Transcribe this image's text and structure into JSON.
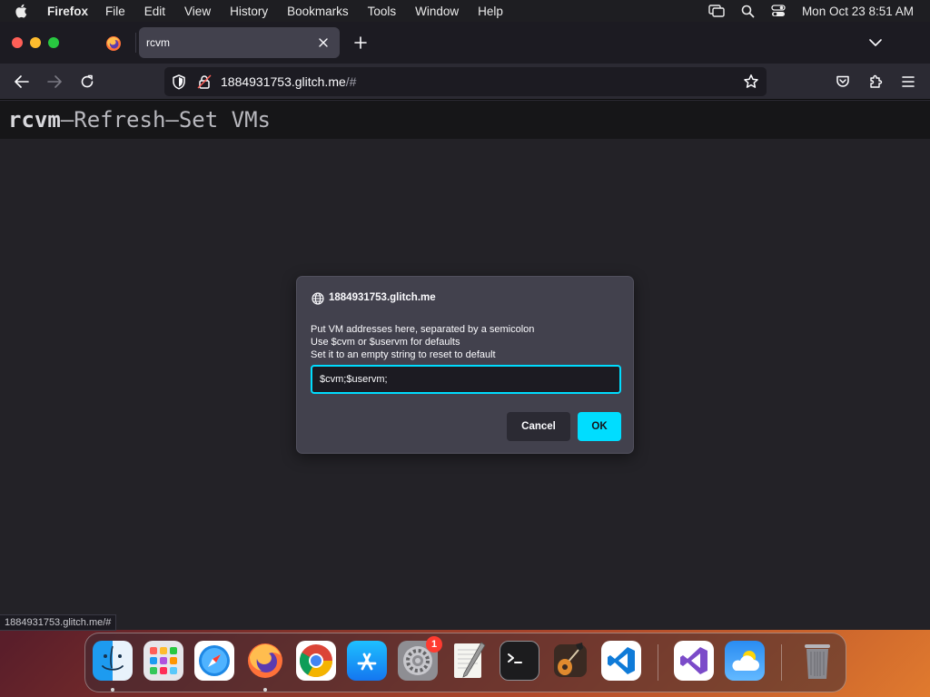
{
  "menubar": {
    "app_name": "Firefox",
    "items": [
      "File",
      "Edit",
      "View",
      "History",
      "Bookmarks",
      "Tools",
      "Window",
      "Help"
    ],
    "clock": "Mon Oct 23  8:51 AM"
  },
  "browser": {
    "active_tab_title": "rcvm",
    "url_host": "1884931753.glitch.me",
    "url_path": "/#"
  },
  "page": {
    "header_title": "rcvm",
    "separator": "–",
    "refresh_link": "Refresh",
    "set_vms_link": "Set VMs"
  },
  "dialog": {
    "host": "1884931753.glitch.me",
    "message_lines": [
      "Put VM addresses here, separated by a semicolon",
      "Use $cvm or $uservm for defaults",
      "Set it to an empty string to reset to default"
    ],
    "input_value": "$cvm;$uservm;",
    "cancel_label": "Cancel",
    "ok_label": "OK"
  },
  "status_url": "1884931753.glitch.me/#",
  "dock": {
    "apps": [
      "Finder",
      "Launchpad",
      "Safari",
      "Firefox",
      "Chrome",
      "App Store",
      "System Settings",
      "TextEdit",
      "Terminal",
      "GarageBand",
      "Visual Studio Code",
      "Visual Studio",
      "Weather",
      "Trash"
    ],
    "settings_badge": "1"
  },
  "colors": {
    "accent": "#00ddff",
    "dialog_bg": "#42414d",
    "page_bg": "#232227"
  }
}
